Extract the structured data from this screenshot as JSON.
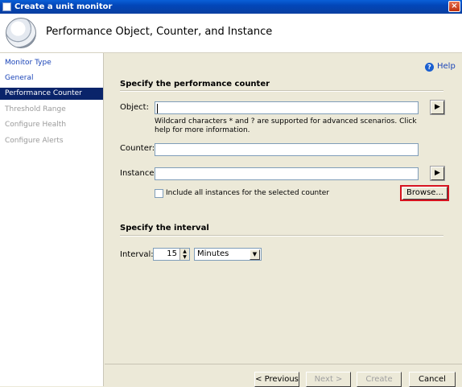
{
  "window": {
    "title": "Create a unit monitor",
    "close_glyph": "×"
  },
  "header": {
    "title": "Performance Object, Counter, and Instance",
    "icon": "wizard-page-icon"
  },
  "nav": {
    "items": [
      {
        "label": "Monitor Type",
        "state": "link"
      },
      {
        "label": "General",
        "state": "link"
      },
      {
        "label": "Performance Counter",
        "state": "selected"
      },
      {
        "label": "Threshold Range",
        "state": "disabled"
      },
      {
        "label": "Configure Health",
        "state": "disabled"
      },
      {
        "label": "Configure Alerts",
        "state": "disabled"
      }
    ]
  },
  "help": {
    "label": "Help",
    "icon_glyph": "?"
  },
  "counter_section": {
    "title": "Specify the performance counter",
    "object_label": "Object:",
    "object_value": "",
    "wildcard_note": "Wildcard characters * and ? are supported for advanced scenarios. Click help for more information.",
    "counter_label": "Counter:",
    "counter_value": "",
    "instance_label": "Instance:",
    "instance_value": "",
    "include_all_label": "Include all instances for the selected counter",
    "include_all_checked": false,
    "browse_label": "Browse...",
    "arrow_glyph": "▶"
  },
  "interval_section": {
    "title": "Specify the interval",
    "interval_label": "Interval:",
    "interval_value": "15",
    "unit_value": "Minutes",
    "spin_up": "▲",
    "spin_down": "▼",
    "select_glyph": "▼"
  },
  "footer": {
    "previous_label": "< Previous",
    "next_label": "Next >",
    "create_label": "Create",
    "cancel_label": "Cancel"
  },
  "colors": {
    "selection": "#0a246a",
    "highlight": "#d6131f",
    "link": "#1a44b8"
  }
}
